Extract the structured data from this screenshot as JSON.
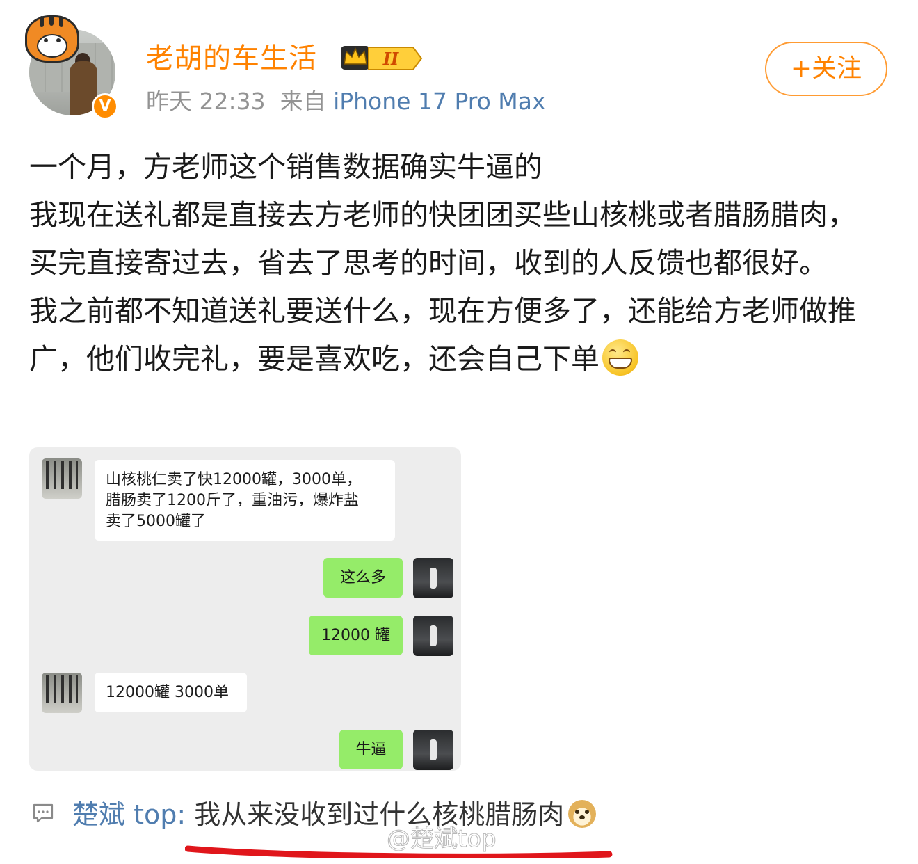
{
  "post": {
    "username": "老胡的车生活",
    "level_badge": "II",
    "verified_badge": "V",
    "time": "昨天 22:33",
    "source_prefix": "来自",
    "device": "iPhone 17 Pro Max",
    "follow_label": "+关注",
    "body_lines": [
      "一个月，方老师这个销售数据确实牛逼的",
      "我现在送礼都是直接去方老师的快团团买些山核桃或者腊肠腊肉，买完直接寄过去，省去了思考的时间，收到的人反馈也都很好。",
      "我之前都不知道送礼要送什么，现在方便多了，还能给方老师做推广，他们收完礼，要是喜欢吃，还会自己下单"
    ],
    "emoji_inline": "grin-emoji"
  },
  "chat": {
    "messages": [
      {
        "side": "left",
        "text_lines": [
          "山核桃仁卖了快12000罐，3000单，",
          "腊肠卖了1200斤了，重油污，爆炸盐",
          "卖了5000罐了"
        ]
      },
      {
        "side": "right",
        "text": "这么多"
      },
      {
        "side": "right",
        "text": "12000 罐"
      },
      {
        "side": "left",
        "text": "12000罐 3000单"
      },
      {
        "side": "right",
        "text": "牛逼"
      }
    ]
  },
  "comment": {
    "icon": "comment-icon",
    "user": "楚斌 top:",
    "text": "我从来没收到过什么核桃腊肠肉",
    "emoji": "doge-emoji"
  },
  "watermark": "@楚斌top",
  "colors": {
    "username": "#ff8200",
    "link_blue": "#507daf",
    "meta_gray": "#939393",
    "wechat_green": "#95ec69",
    "annotation_red": "#e0161b"
  }
}
